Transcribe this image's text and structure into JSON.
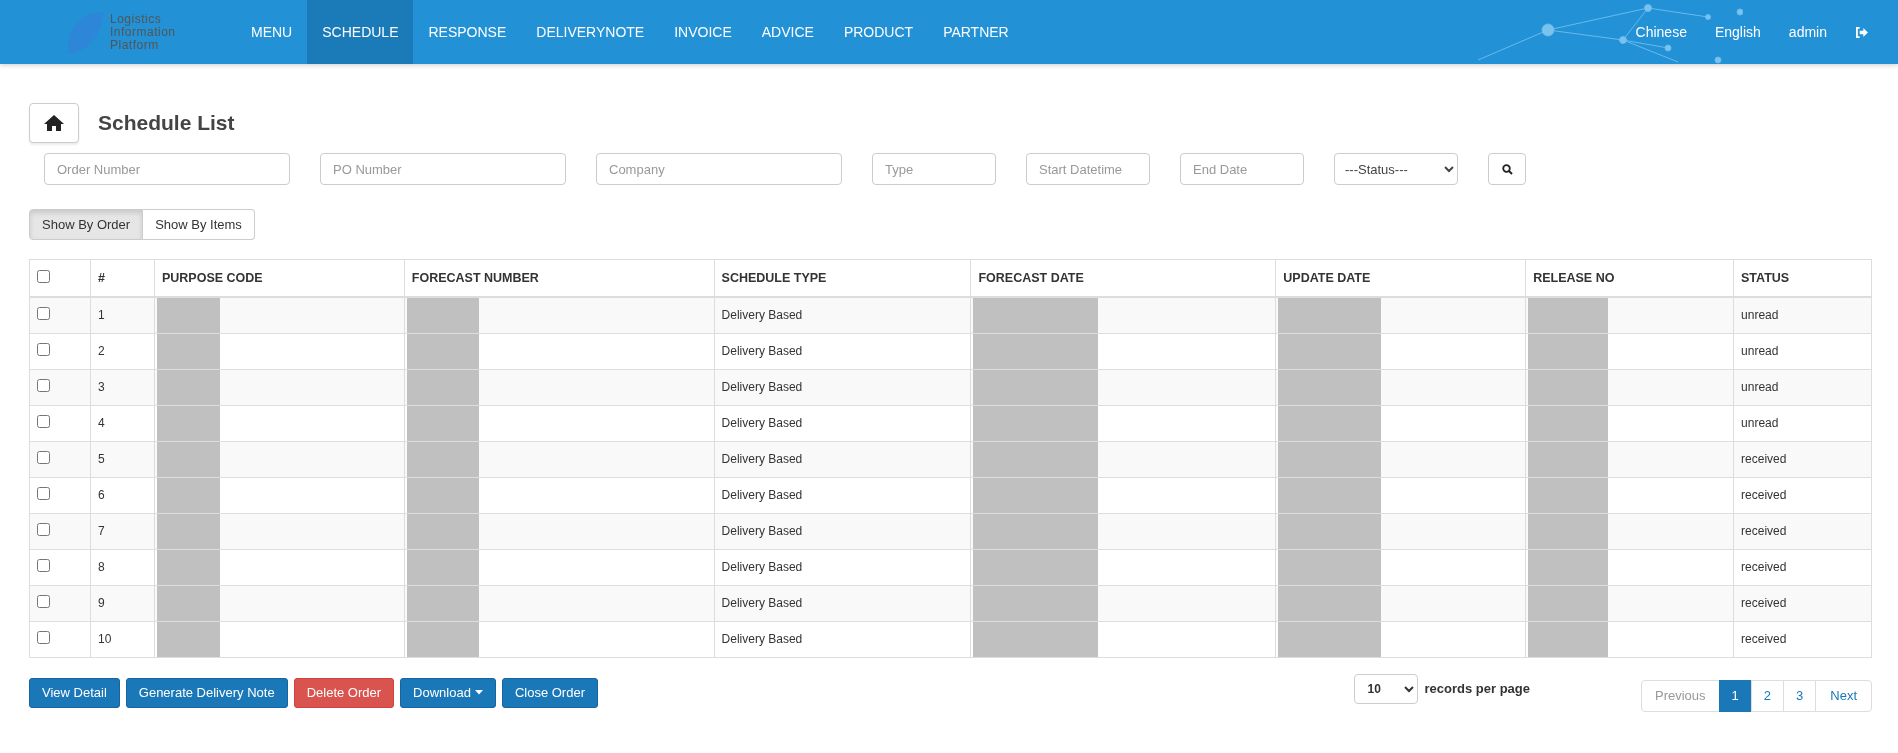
{
  "header": {
    "logo_lines": [
      "Logistics",
      "Information",
      "Platform"
    ],
    "nav": [
      {
        "label": "MENU",
        "selected": false
      },
      {
        "label": "SCHEDULE",
        "selected": true
      },
      {
        "label": "RESPONSE",
        "selected": false
      },
      {
        "label": "DELIVERYNOTE",
        "selected": false
      },
      {
        "label": "INVOICE",
        "selected": false
      },
      {
        "label": "ADVICE",
        "selected": false
      },
      {
        "label": "PRODUCT",
        "selected": false
      },
      {
        "label": "PARTNER",
        "selected": false
      }
    ],
    "right_links": [
      "Chinese",
      "English",
      "admin"
    ]
  },
  "page_title": "Schedule List",
  "filters": [
    {
      "kind": "text",
      "placeholder": "Order Number"
    },
    {
      "kind": "text",
      "placeholder": "PO Number"
    },
    {
      "kind": "text",
      "placeholder": "Company"
    },
    {
      "kind": "text",
      "placeholder": "Type"
    },
    {
      "kind": "text",
      "placeholder": "Start Datetime"
    },
    {
      "kind": "text",
      "placeholder": "End Date"
    },
    {
      "kind": "select",
      "value": "---Status---"
    }
  ],
  "view_toggle": [
    {
      "label": "Show By Order",
      "selected": true
    },
    {
      "label": "Show By Items",
      "selected": false
    }
  ],
  "table": {
    "select_all_checked": false,
    "columns": [
      {
        "label": "#",
        "redacted": false
      },
      {
        "label": "PURPOSE CODE",
        "redacted": true
      },
      {
        "label": "FORECAST NUMBER",
        "redacted": true
      },
      {
        "label": "SCHEDULE TYPE",
        "redacted": false
      },
      {
        "label": "FORECAST DATE",
        "redacted": true
      },
      {
        "label": "UPDATE DATE",
        "redacted": true
      },
      {
        "label": "RELEASE NO",
        "redacted": true
      },
      {
        "label": "STATUS",
        "redacted": false
      }
    ],
    "rows": [
      {
        "checked": false,
        "cells": [
          "1",
          "",
          "",
          "Delivery Based",
          "",
          "",
          "",
          "unread"
        ]
      },
      {
        "checked": false,
        "cells": [
          "2",
          "",
          "",
          "Delivery Based",
          "",
          "",
          "",
          "unread"
        ]
      },
      {
        "checked": false,
        "cells": [
          "3",
          "",
          "",
          "Delivery Based",
          "",
          "",
          "",
          "unread"
        ]
      },
      {
        "checked": false,
        "cells": [
          "4",
          "",
          "",
          "Delivery Based",
          "",
          "",
          "",
          "unread"
        ]
      },
      {
        "checked": false,
        "cells": [
          "5",
          "",
          "",
          "Delivery Based",
          "",
          "",
          "",
          "received"
        ]
      },
      {
        "checked": false,
        "cells": [
          "6",
          "",
          "",
          "Delivery Based",
          "",
          "",
          "",
          "received"
        ]
      },
      {
        "checked": false,
        "cells": [
          "7",
          "",
          "",
          "Delivery Based",
          "",
          "",
          "",
          "received"
        ]
      },
      {
        "checked": false,
        "cells": [
          "8",
          "",
          "",
          "Delivery Based",
          "",
          "",
          "",
          "received"
        ]
      },
      {
        "checked": false,
        "cells": [
          "9",
          "",
          "",
          "Delivery Based",
          "",
          "",
          "",
          "received"
        ]
      },
      {
        "checked": false,
        "cells": [
          "10",
          "",
          "",
          "Delivery Based",
          "",
          "",
          "",
          "received"
        ]
      }
    ]
  },
  "actions": [
    {
      "label": "View Detail",
      "kind": "primary",
      "dropdown": false
    },
    {
      "label": "Generate Delivery Note",
      "kind": "primary",
      "dropdown": false
    },
    {
      "label": "Delete Order",
      "kind": "danger",
      "dropdown": false
    },
    {
      "label": "Download",
      "kind": "primary",
      "dropdown": true
    },
    {
      "label": "Close Order",
      "kind": "primary",
      "dropdown": false
    }
  ],
  "page_size": {
    "value": "10",
    "label": "records per page"
  },
  "pagination": [
    {
      "label": "Previous",
      "kind": "prev",
      "selected": false,
      "disabled": true
    },
    {
      "label": "1",
      "kind": "page",
      "selected": true,
      "disabled": false
    },
    {
      "label": "2",
      "kind": "page",
      "selected": false,
      "disabled": false
    },
    {
      "label": "3",
      "kind": "page",
      "selected": false,
      "disabled": false
    },
    {
      "label": "Next",
      "kind": "next",
      "selected": false,
      "disabled": false
    }
  ]
}
